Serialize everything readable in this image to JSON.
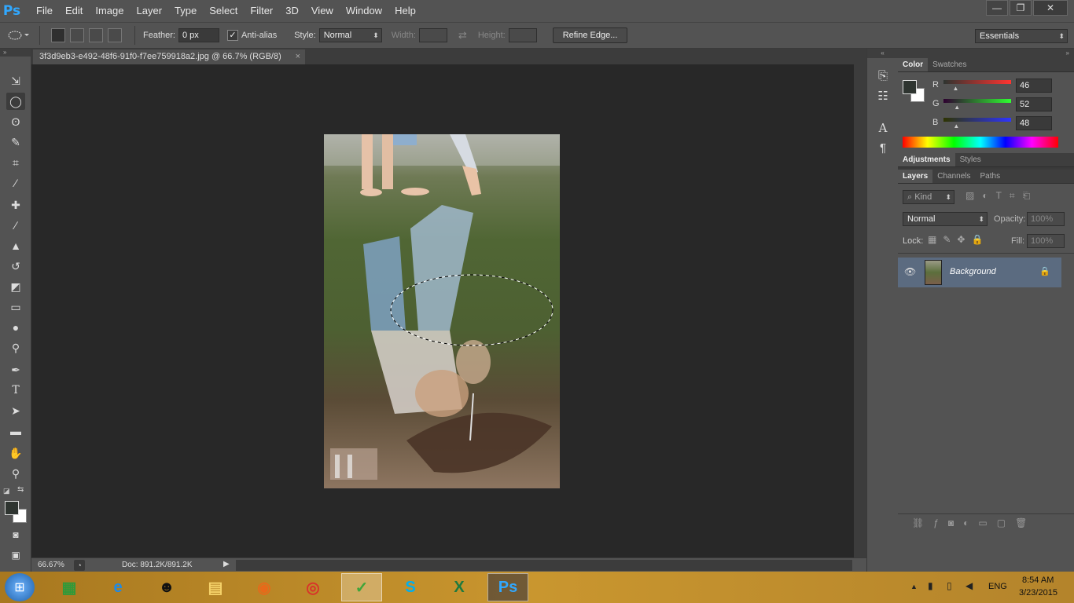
{
  "app": {
    "logo": "Ps"
  },
  "menu": [
    "File",
    "Edit",
    "Image",
    "Layer",
    "Type",
    "Select",
    "Filter",
    "3D",
    "View",
    "Window",
    "Help"
  ],
  "window_buttons": {
    "minimize": "—",
    "maximize": "❐",
    "close": "✕"
  },
  "options_bar": {
    "feather_label": "Feather:",
    "feather_value": "0 px",
    "antialias_label": "Anti-alias",
    "antialias_checked": true,
    "style_label": "Style:",
    "style_value": "Normal",
    "width_label": "Width:",
    "height_label": "Height:",
    "refine_edge": "Refine Edge...",
    "workspace": "Essentials"
  },
  "document": {
    "tab_title": "3f3d9eb3-e492-48f6-91f0-f7ee759918a2.jpg @ 66.7% (RGB/8)",
    "close_glyph": "×"
  },
  "status": {
    "zoom": "66.67%",
    "doc": "Doc: 891.2K/891.2K"
  },
  "color_panel": {
    "tabs": [
      "Color",
      "Swatches"
    ],
    "r_label": "R",
    "g_label": "G",
    "b_label": "B",
    "r": "46",
    "g": "52",
    "b": "48",
    "r_fraction": 0.18,
    "g_fraction": 0.2,
    "b_fraction": 0.19
  },
  "adjustments_panel": {
    "tabs": [
      "Adjustments",
      "Styles"
    ]
  },
  "layers_panel": {
    "tabs": [
      "Layers",
      "Channels",
      "Paths"
    ],
    "kind": "Kind",
    "blend_mode": "Normal",
    "opacity_label": "Opacity:",
    "opacity_value": "100%",
    "lock_label": "Lock:",
    "fill_label": "Fill:",
    "fill_value": "100%",
    "layers": [
      {
        "name": "Background",
        "visible": true,
        "locked": true
      }
    ]
  },
  "taskbar": {
    "language": "ENG",
    "time": "8:54 AM",
    "date": "3/23/2015"
  },
  "colors": {
    "accent_ps": "#31a8ff",
    "foreground": "#2e3430",
    "background": "#ffffff"
  }
}
